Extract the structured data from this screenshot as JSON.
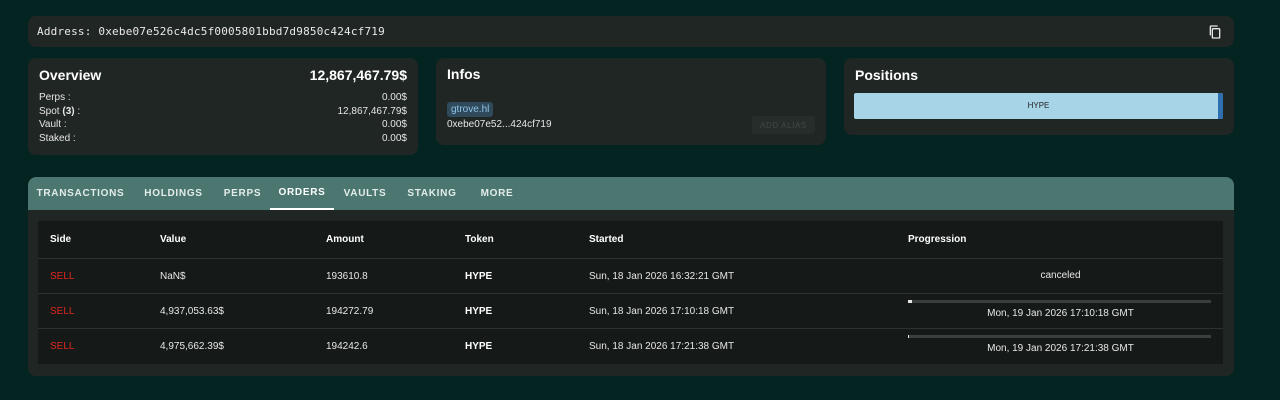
{
  "address": {
    "text": "Address: 0xebe07e526c4dc5f0005801bbd7d9850c424cf719",
    "copy_icon": "copy-icon"
  },
  "overview": {
    "title": "Overview",
    "total": "12,867,467.79$",
    "rows": [
      {
        "label": "Perps :",
        "value": "0.00$"
      },
      {
        "label_prefix": "Spot ",
        "label_count": "(3)",
        "label_suffix": " :",
        "value": "12,867,467.79$"
      },
      {
        "label": "Vault :",
        "value": "0.00$"
      },
      {
        "label": "Staked :",
        "value": "0.00$"
      }
    ]
  },
  "infos": {
    "title": "Infos",
    "alias": "gtrove.hl",
    "address_short": "0xebe07e52...424cf719",
    "add_alias_label": "ADD ALIAS"
  },
  "positions": {
    "title": "Positions",
    "bar_label": "HYPE",
    "bar_color": "#a8d4e8",
    "bar_tail_color": "#2e6fb0"
  },
  "tabs": [
    {
      "label": "TRANSACTIONS"
    },
    {
      "label": "HOLDINGS"
    },
    {
      "label": "PERPS"
    },
    {
      "label": "ORDERS",
      "active": true
    },
    {
      "label": "VAULTS"
    },
    {
      "label": "STAKING"
    },
    {
      "label": "MORE"
    }
  ],
  "orders": {
    "headers": [
      "Side",
      "Value",
      "Amount",
      "Token",
      "Started",
      "Progression"
    ],
    "rows": [
      {
        "side": "SELL",
        "value": "NaN$",
        "amount": "193610.8",
        "token": "HYPE",
        "started": "Sun, 18 Jan 2026 16:32:21 GMT",
        "progression_text": "canceled",
        "progress": null
      },
      {
        "side": "SELL",
        "value": "4,937,053.63$",
        "amount": "194272.79",
        "token": "HYPE",
        "started": "Sun, 18 Jan 2026 17:10:18 GMT",
        "progression_text": "Mon, 19 Jan 2026 17:10:18 GMT",
        "progress": 0.013
      },
      {
        "side": "SELL",
        "value": "4,975,662.39$",
        "amount": "194242.6",
        "token": "HYPE",
        "started": "Sun, 18 Jan 2026 17:21:38 GMT",
        "progression_text": "Mon, 19 Jan 2026 17:21:38 GMT",
        "progress": 0.004
      }
    ]
  },
  "colors": {
    "background": "#032420",
    "panel": "#202624",
    "tab_bar": "#4b7770",
    "sell": "#e0261f"
  }
}
